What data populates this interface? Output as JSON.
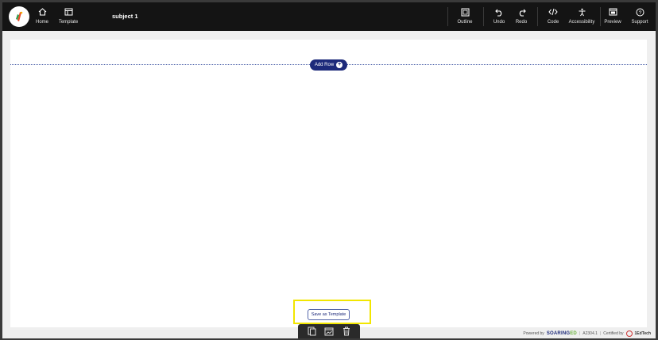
{
  "toolbar": {
    "home_label": "Home",
    "template_label": "Template",
    "document_title": "subject 1",
    "outline_label": "Outline",
    "undo_label": "Undo",
    "redo_label": "Redo",
    "code_label": "Code",
    "accessibility_label": "Accessibility",
    "preview_label": "Preview",
    "support_label": "Support"
  },
  "canvas": {
    "add_row_label": "Add Row",
    "save_template_label": "Save as Template"
  },
  "footer": {
    "powered_by": "Powered by",
    "brand_main": "SOARING",
    "brand_accent": "ED",
    "separator": "|",
    "version": "A2304.1",
    "certified_by": "Certified by",
    "cert_name": "1EdTech"
  },
  "colors": {
    "topbar_bg": "#141414",
    "accent_navy": "#1d2a7a",
    "highlight_yellow": "#f2e600",
    "brand_green": "#6cb33f"
  },
  "icons": {
    "logo": "app-logo-icon",
    "home": "home-icon",
    "template": "template-icon",
    "outline": "outline-icon",
    "undo": "undo-icon",
    "redo": "redo-icon",
    "code": "code-icon",
    "accessibility": "accessibility-icon",
    "preview": "preview-icon",
    "support": "help-icon",
    "bottom_tools": [
      "copy-icon",
      "image-icon",
      "trash-icon"
    ]
  }
}
